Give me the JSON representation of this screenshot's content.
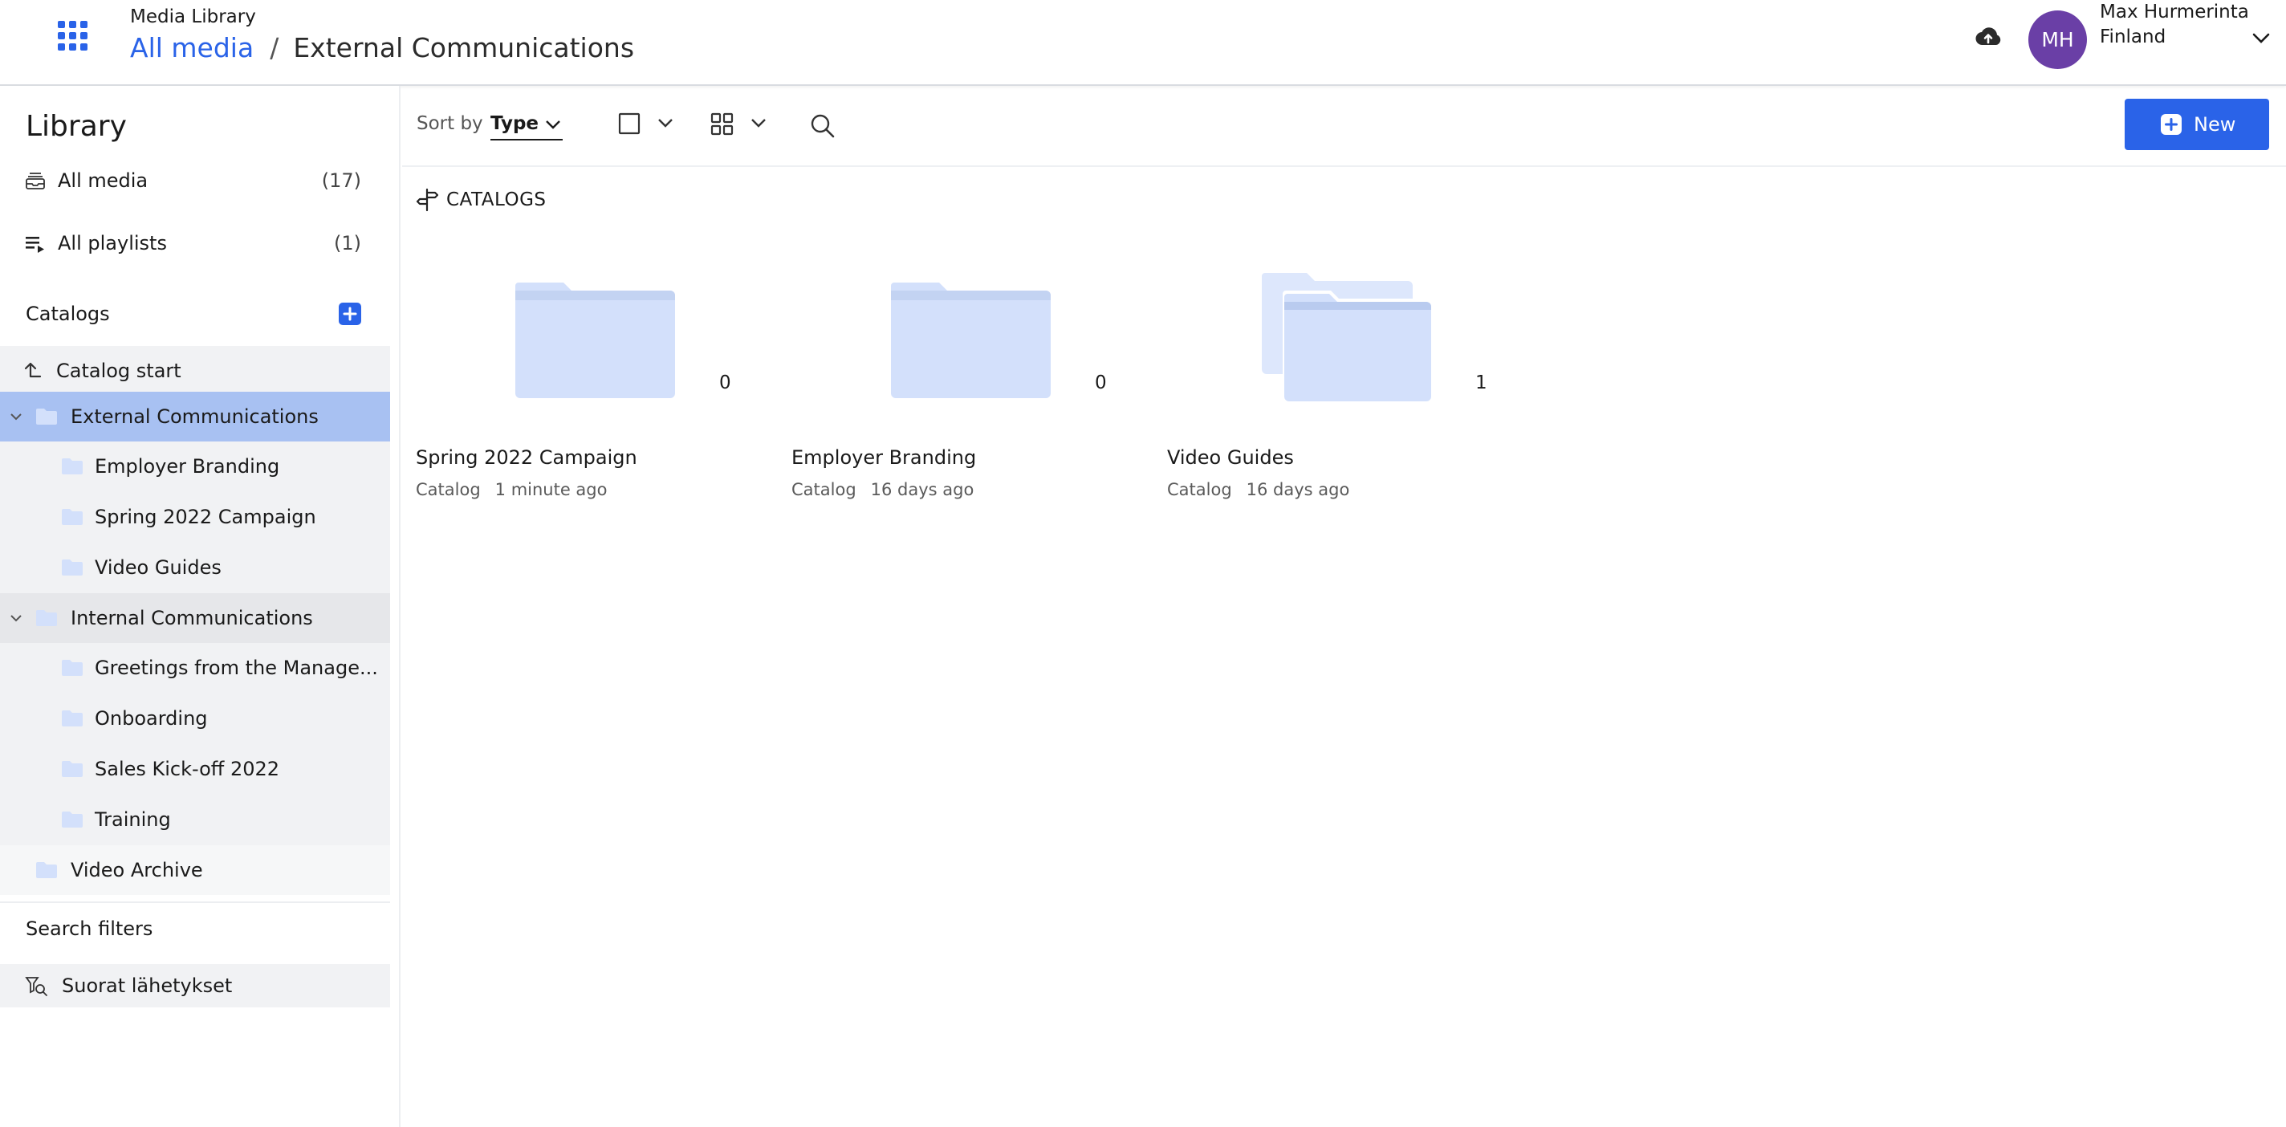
{
  "header": {
    "app_name": "Media Library",
    "breadcrumb_root": "All media",
    "breadcrumb_separator": "/",
    "breadcrumb_current": "External Communications",
    "user_initials": "MH",
    "user_name": "Max Hurmerinta Finland",
    "avatar_color": "#6a3fa6",
    "accent_color": "#2a63e8"
  },
  "sidebar": {
    "title": "Library",
    "all_media": {
      "label": "All media",
      "count": "(17)"
    },
    "all_playlists": {
      "label": "All playlists",
      "count": "(1)"
    },
    "catalogs_label": "Catalogs",
    "catalog_start": "Catalog start",
    "tree": [
      {
        "label": "External Communications",
        "selected": true,
        "expanded": true,
        "children": [
          "Employer Branding",
          "Spring 2022 Campaign",
          "Video Guides"
        ]
      },
      {
        "label": "Internal Communications",
        "selected": false,
        "expanded": true,
        "children": [
          "Greetings from the Manage...",
          "Onboarding",
          "Sales Kick-off 2022",
          "Training"
        ]
      },
      {
        "label": "Video Archive",
        "selected": false,
        "expanded": false,
        "children": []
      }
    ],
    "search_filters_label": "Search filters",
    "saved_filter": "Suorat lähetykset"
  },
  "toolbar": {
    "sort_label": "Sort by",
    "sort_value": "Type",
    "new_label": "New"
  },
  "content": {
    "section_label": "CATALOGS",
    "cards": [
      {
        "title": "Spring 2022 Campaign",
        "type": "Catalog",
        "updated": "1 minute ago",
        "count": "0"
      },
      {
        "title": "Employer Branding",
        "type": "Catalog",
        "updated": "16 days ago",
        "count": "0"
      },
      {
        "title": "Video Guides",
        "type": "Catalog",
        "updated": "16 days ago",
        "count": "1"
      }
    ]
  }
}
